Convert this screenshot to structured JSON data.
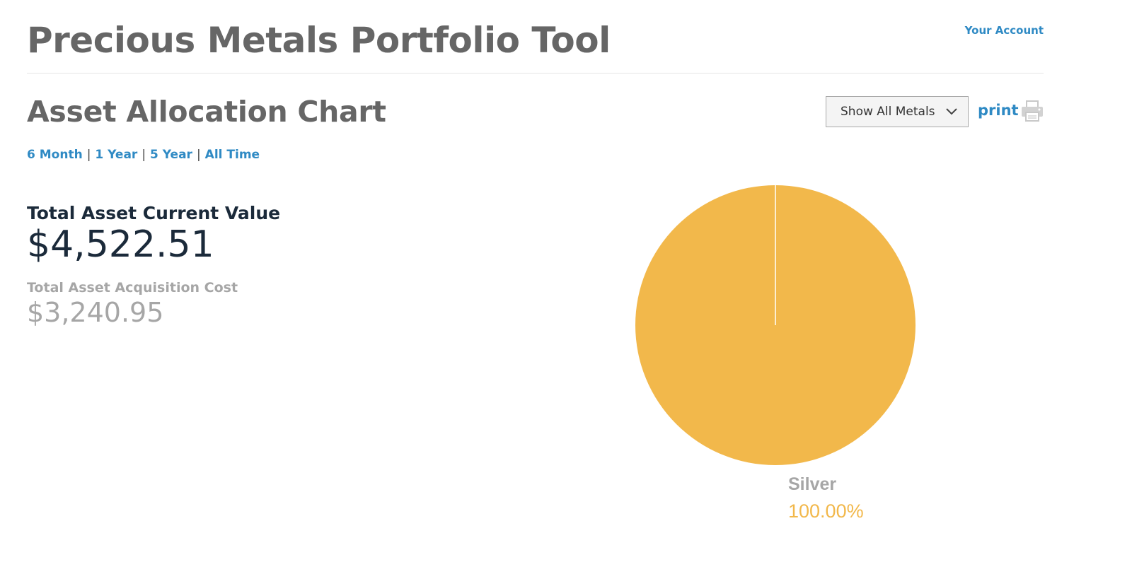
{
  "header": {
    "title": "Precious Metals Portfolio Tool",
    "account_link": "Your Account"
  },
  "section": {
    "title": "Asset Allocation Chart",
    "metal_filter": {
      "selected": "Show All Metals"
    },
    "print_label": "print",
    "time_ranges": [
      "6 Month",
      "1 Year",
      "5 Year",
      "All Time"
    ]
  },
  "summary": {
    "current_value_label": "Total Asset Current Value",
    "current_value": "$4,522.51",
    "acquisition_cost_label": "Total Asset Acquisition Cost",
    "acquisition_cost": "$3,240.95"
  },
  "colors": {
    "link": "#2f8ac4",
    "silver_slice": "#f2b84b",
    "label_gray": "#a6a6a6"
  },
  "icons": {
    "print": "printer-icon",
    "select": "chevron-down-icon"
  },
  "chart_data": {
    "type": "pie",
    "slices": [
      {
        "label": "Silver",
        "value": 100.0,
        "display": "100.00%",
        "color": "#f2b84b"
      }
    ]
  }
}
